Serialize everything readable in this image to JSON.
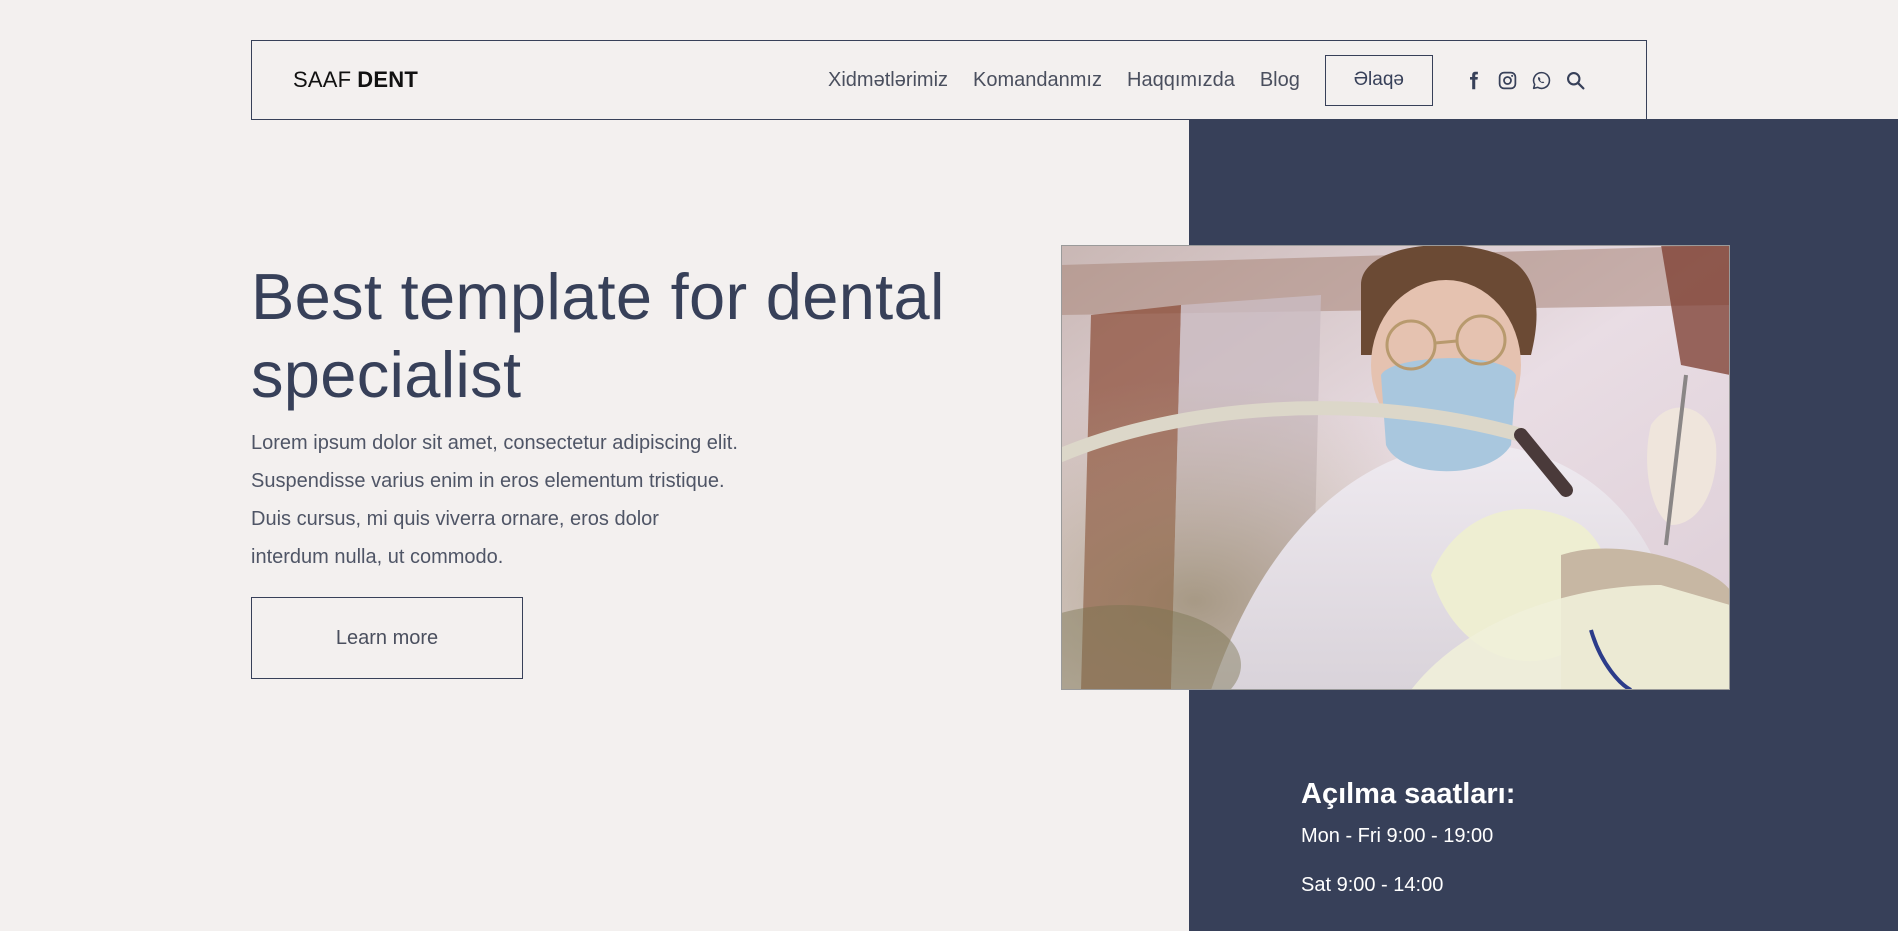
{
  "brand": {
    "part1": "SAAF",
    "part2": "DENT"
  },
  "nav": {
    "links": [
      "Xidmətlərimiz",
      "Komandanmız",
      "Haqqımızda",
      "Blog"
    ],
    "contact_label": "Əlaqə",
    "social_icons": [
      "facebook-icon",
      "instagram-icon",
      "whatsapp-icon",
      "search-icon"
    ]
  },
  "hero": {
    "title": "Best template for dental specialist",
    "text": "Lorem ipsum dolor sit amet, consectetur adipiscing elit. Suspendisse varius enim in eros elementum tristique. Duis cursus, mi quis viverra ornare, eros dolor interdum nulla, ut commodo.",
    "button_label": "Learn more"
  },
  "hours": {
    "title": "Açılma saatları:",
    "lines": [
      "Mon - Fri 9:00 - 19:00",
      "Sat 9:00 - 14:00"
    ]
  },
  "colors": {
    "page_bg": "#f3f0ef",
    "accent_dark": "#374059",
    "panel_text": "#ffffff"
  }
}
